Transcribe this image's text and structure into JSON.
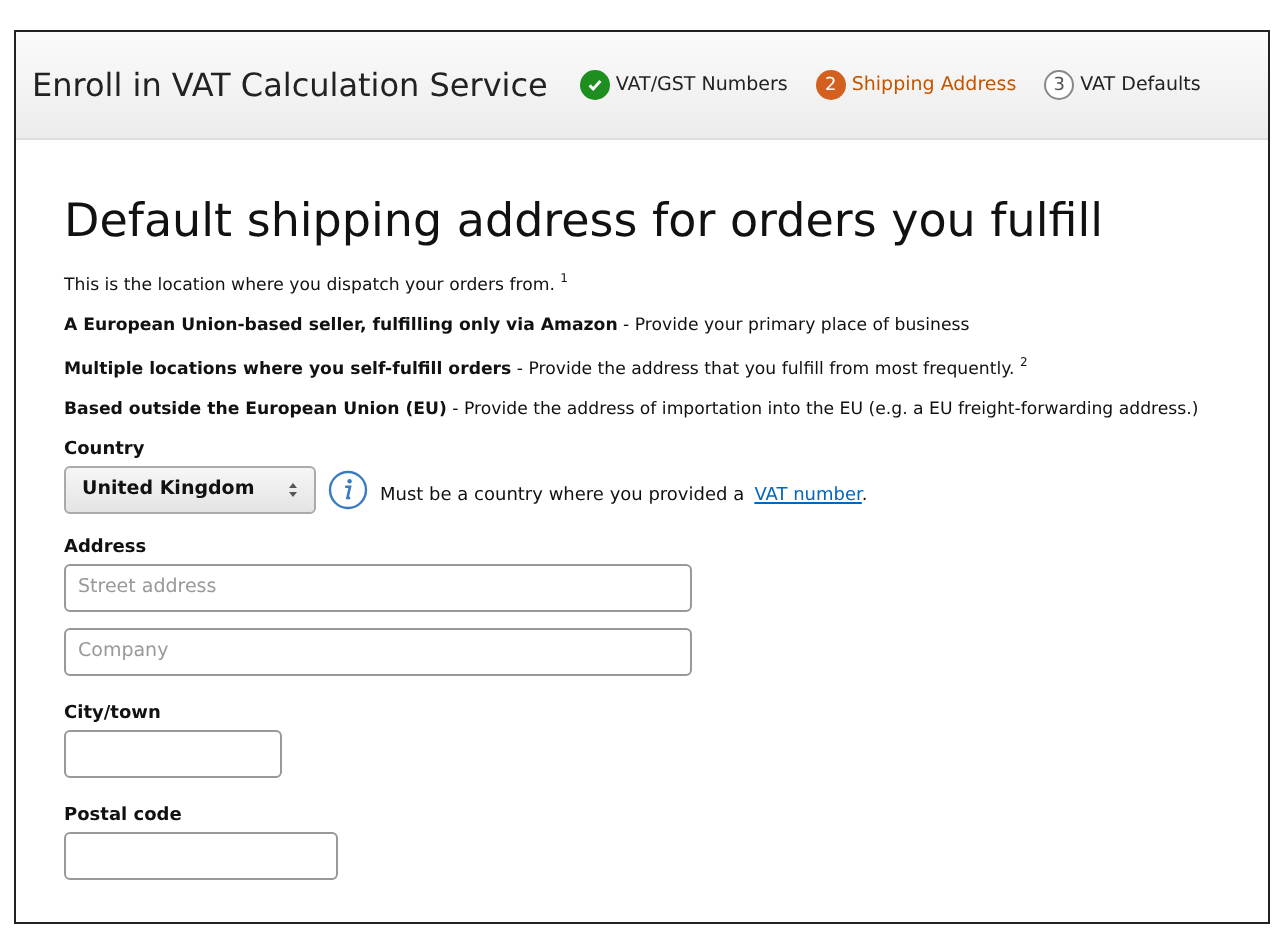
{
  "header": {
    "title": "Enroll in VAT Calculation Service",
    "steps": [
      {
        "label": "VAT/GST Numbers",
        "completed": true,
        "selected": false
      },
      {
        "label": "Shipping Address",
        "completed": false,
        "selected": true,
        "number": "2"
      },
      {
        "label": "VAT Defaults",
        "completed": false,
        "selected": false,
        "number": "3"
      }
    ]
  },
  "heading": "Default shipping address for orders you fulfill",
  "paragraphs": [
    "This is the location where you dispatch your orders from. $^{1}$",
    "**A European Union-based seller, fulfilling only via Amazon** - Provide your primary place of business",
    "**Multiple locations where you self-fulfill orders** - Provide the address that you fulfill from most frequently. $^{2}$",
    "**Based outside the European Union (EU)** - Provide the address of importation into the EU (e.g. a EU freight-forwarding address.)"
  ],
  "country": {
    "label": "Country",
    "value": "United Kingdom",
    "hint": "Must be a country where you provided a",
    "link": "VAT number",
    "after_link": "."
  },
  "address": {
    "label": "Address",
    "fields": [
      {
        "placeholder": "Street address"
      },
      {
        "placeholder": "Company"
      }
    ]
  },
  "city": {
    "label": "City/town"
  },
  "postal": {
    "label": "Postal code"
  }
}
